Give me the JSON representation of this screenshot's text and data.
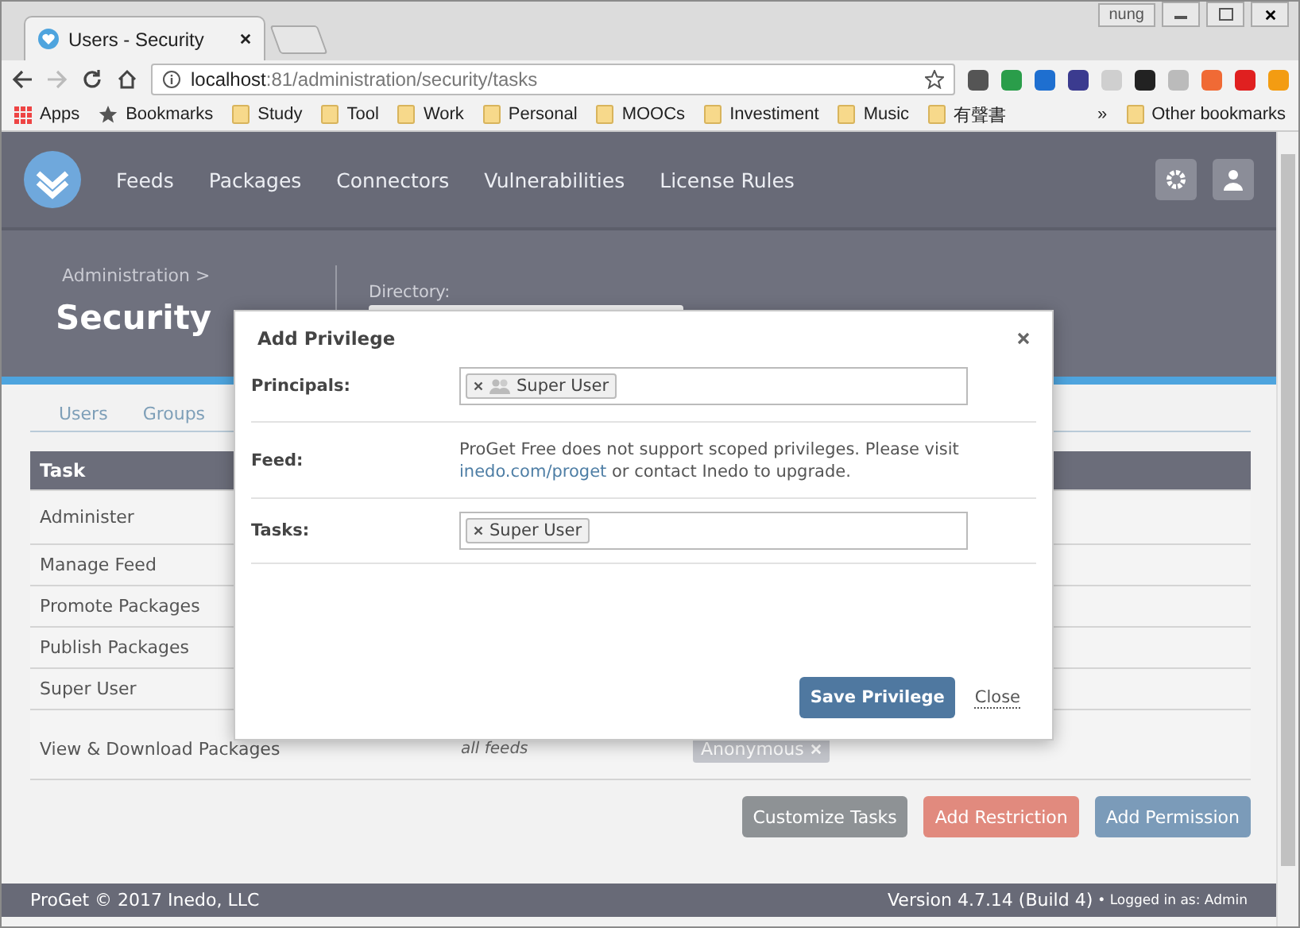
{
  "browser": {
    "tab_title": "Users - Security",
    "profile": "nung",
    "url_host": "localhost",
    "url_path": ":81/administration/security/tasks",
    "bookmarks": [
      {
        "kind": "apps",
        "label": "Apps"
      },
      {
        "kind": "star",
        "label": "Bookmarks"
      },
      {
        "kind": "folder",
        "label": "Study"
      },
      {
        "kind": "folder",
        "label": "Tool"
      },
      {
        "kind": "folder",
        "label": "Work"
      },
      {
        "kind": "folder",
        "label": "Personal"
      },
      {
        "kind": "folder",
        "label": "MOOCs"
      },
      {
        "kind": "folder",
        "label": "Investiment"
      },
      {
        "kind": "folder",
        "label": "Music"
      },
      {
        "kind": "folder",
        "label": "有聲書"
      }
    ],
    "overflow": "»",
    "other_bookmarks": "Other bookmarks"
  },
  "nav": {
    "items": [
      "Feeds",
      "Packages",
      "Connectors",
      "Vulnerabilities",
      "License Rules"
    ]
  },
  "header": {
    "breadcrumb": "Administration >",
    "title": "Security",
    "directory_label": "Directory:"
  },
  "subtabs": [
    {
      "label": "Users",
      "selected": false
    },
    {
      "label": "Groups",
      "selected": false
    }
  ],
  "table": {
    "columns": [
      "Task"
    ],
    "rows": [
      {
        "task": "Administer"
      },
      {
        "task": "Manage Feed"
      },
      {
        "task": "Promote Packages"
      },
      {
        "task": "Publish Packages"
      },
      {
        "task": "Super User"
      },
      {
        "task": "View & Download Packages",
        "scope": "all feeds",
        "principal": "Anonymous"
      }
    ]
  },
  "actions": [
    {
      "label": "Customize Tasks",
      "kind": "neutral"
    },
    {
      "label": "Add Restriction",
      "kind": "danger"
    },
    {
      "label": "Add Permission",
      "kind": "primary"
    }
  ],
  "footer": {
    "left": "ProGet © 2017 Inedo, LLC",
    "version": "Version 4.7.14 (Build 4)",
    "logged_in": "• Logged in as: Admin"
  },
  "dialog": {
    "title": "Add Privilege",
    "principals": {
      "label": "Principals:",
      "tags": [
        "Super User"
      ]
    },
    "feed": {
      "label": "Feed:",
      "text_before": "ProGet Free does not support scoped privileges. Please visit ",
      "link": "inedo.com/proget",
      "text_after": " or contact Inedo to upgrade."
    },
    "tasks": {
      "label": "Tasks:",
      "tags": [
        "Super User"
      ]
    },
    "save": "Save Privilege",
    "close": "Close"
  }
}
